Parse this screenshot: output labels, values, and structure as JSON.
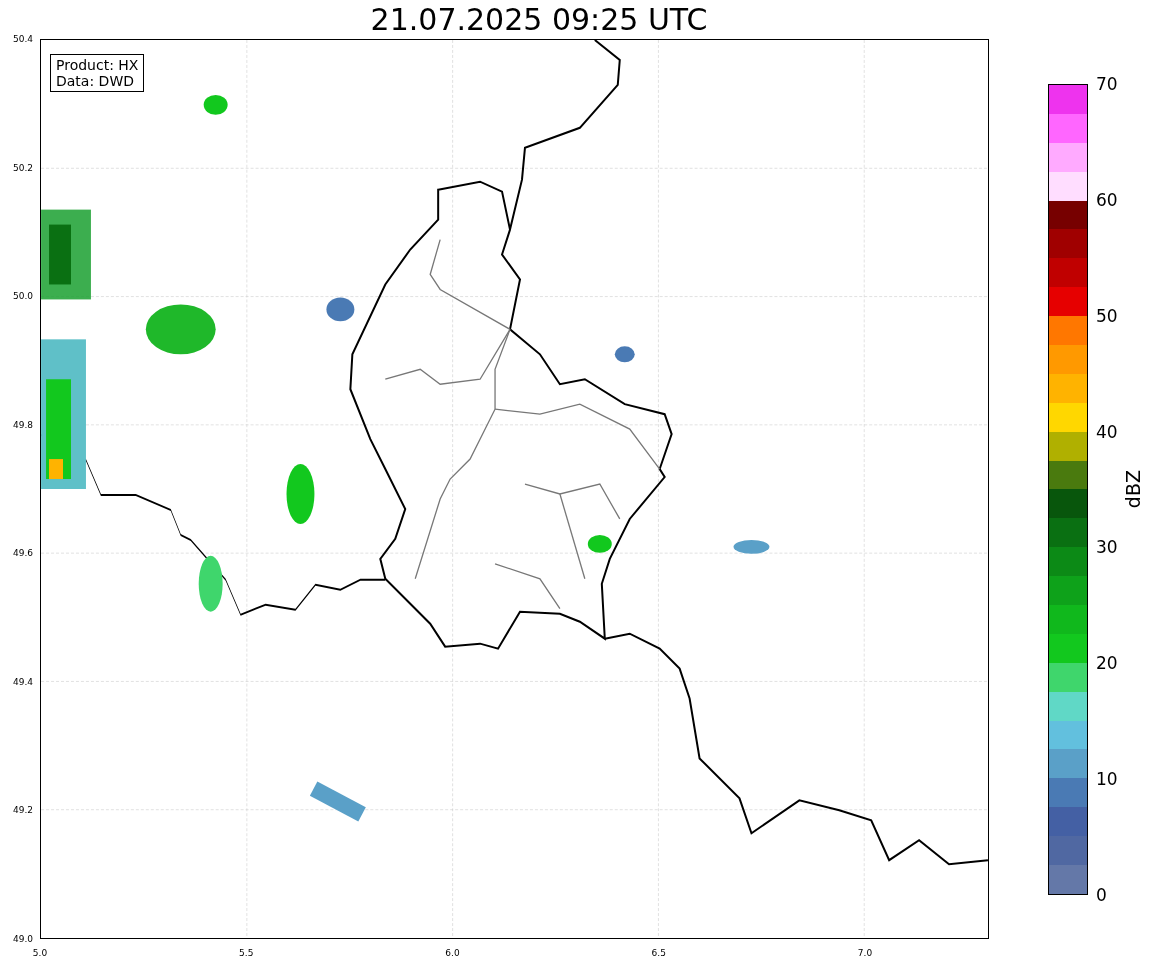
{
  "title": "21.07.2025 09:25 UTC",
  "info_box": {
    "lines": [
      "Product: HX",
      "Data: DWD"
    ]
  },
  "x_axis": {
    "ticks": [
      "5.0",
      "5.5",
      "6.0",
      "6.5",
      "7.0"
    ]
  },
  "y_axis": {
    "ticks": [
      "50.4",
      "50.2",
      "50.0",
      "49.8",
      "49.6",
      "49.4",
      "49.2",
      "49.0"
    ]
  },
  "colorbar": {
    "label": "dBZ",
    "ticks": [
      "70",
      "60",
      "50",
      "40",
      "30",
      "20",
      "10",
      "0"
    ],
    "bands": [
      {
        "color": "#6478a8"
      },
      {
        "color": "#5068a2"
      },
      {
        "color": "#4460a4"
      },
      {
        "color": "#4a7ab4"
      },
      {
        "color": "#5aa0c8"
      },
      {
        "color": "#62c0de"
      },
      {
        "color": "#60d8c6"
      },
      {
        "color": "#3fd66c"
      },
      {
        "color": "#12c81e"
      },
      {
        "color": "#10b81c"
      },
      {
        "color": "#0ea21a"
      },
      {
        "color": "#0c8a16"
      },
      {
        "color": "#0a7012"
      },
      {
        "color": "#08560c"
      },
      {
        "color": "#4a7a0e"
      },
      {
        "color": "#b0b000"
      },
      {
        "color": "#ffd700"
      },
      {
        "color": "#ffb300"
      },
      {
        "color": "#ff9900"
      },
      {
        "color": "#ff7700"
      },
      {
        "color": "#e60000"
      },
      {
        "color": "#c00000"
      },
      {
        "color": "#a00000"
      },
      {
        "color": "#770000"
      },
      {
        "color": "#ffddff"
      },
      {
        "color": "#ffaaff"
      },
      {
        "color": "#ff66ff"
      },
      {
        "color": "#ee33ee"
      }
    ]
  }
}
